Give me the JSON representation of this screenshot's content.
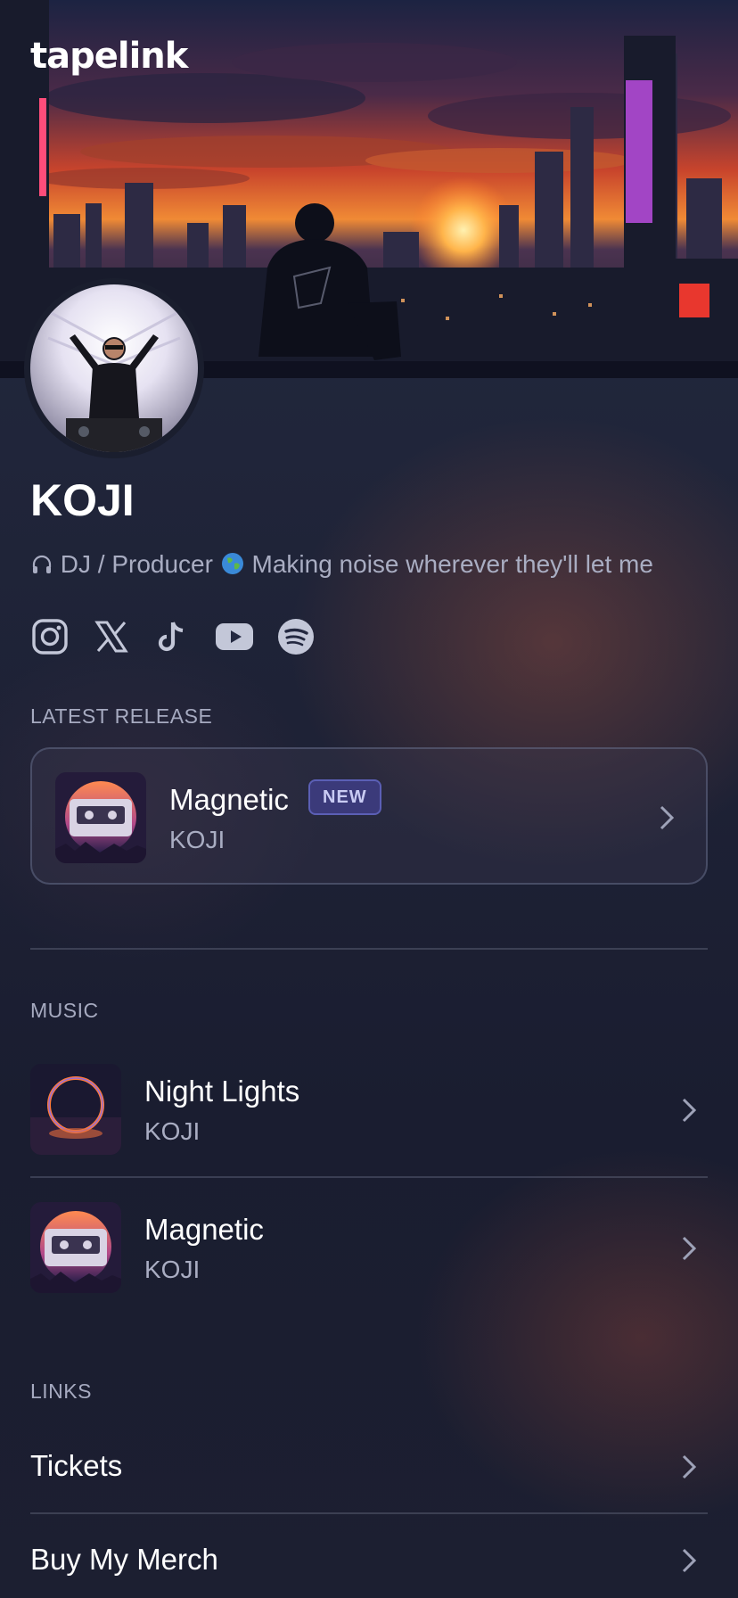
{
  "app": {
    "brand": "tapelink"
  },
  "profile": {
    "name": "KOJI",
    "bio": "DJ / Producer",
    "bio_tail": "Making noise wherever they'll let me"
  },
  "social_icons": [
    "instagram-icon",
    "x-icon",
    "tiktok-icon",
    "youtube-icon",
    "spotify-icon"
  ],
  "latest_release": {
    "section_title": "LATEST RELEASE",
    "title": "Magnetic",
    "badge": "NEW",
    "artist": "KOJI"
  },
  "music": {
    "section_title": "MUSIC",
    "tracks": [
      {
        "title": "Night Lights",
        "artist": "KOJI"
      },
      {
        "title": "Magnetic",
        "artist": "KOJI"
      }
    ]
  },
  "links": {
    "section_title": "LINKS",
    "items": [
      {
        "label": "Tickets"
      },
      {
        "label": "Buy My Merch"
      }
    ]
  },
  "colors": {
    "background": "#1e2236",
    "muted_text": "#a9adc2",
    "badge_bg": "#3b3a7a",
    "badge_text": "#c9cbf3"
  }
}
